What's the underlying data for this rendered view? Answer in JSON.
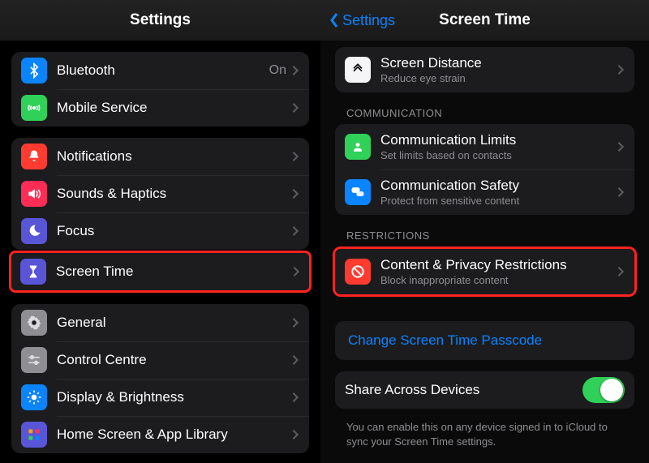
{
  "left": {
    "title": "Settings",
    "group_top": [
      {
        "label": "Bluetooth",
        "value": "On"
      },
      {
        "label": "Mobile Service",
        "value": ""
      }
    ],
    "group_mid": [
      {
        "label": "Notifications"
      },
      {
        "label": "Sounds & Haptics"
      },
      {
        "label": "Focus"
      }
    ],
    "screen_time_label": "Screen Time",
    "group_bottom": [
      {
        "label": "General"
      },
      {
        "label": "Control Centre"
      },
      {
        "label": "Display & Brightness"
      },
      {
        "label": "Home Screen & App Library"
      }
    ]
  },
  "right": {
    "back_label": "Settings",
    "title": "Screen Time",
    "distance": {
      "title": "Screen Distance",
      "sub": "Reduce eye strain"
    },
    "section_comm": "COMMUNICATION",
    "comm_limits": {
      "title": "Communication Limits",
      "sub": "Set limits based on contacts"
    },
    "comm_safety": {
      "title": "Communication Safety",
      "sub": "Protect from sensitive content"
    },
    "section_restr": "RESTRICTIONS",
    "restrictions": {
      "title": "Content & Privacy Restrictions",
      "sub": "Block inappropriate content"
    },
    "change_passcode": "Change Screen Time Passcode",
    "share": {
      "title": "Share Across Devices"
    },
    "share_note": "You can enable this on any device signed in to iCloud to sync your Screen Time settings."
  }
}
